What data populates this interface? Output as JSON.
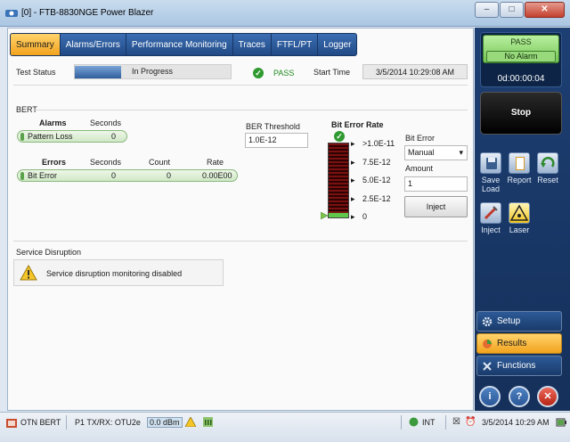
{
  "window": {
    "title": "[0] - FTB-8830NGE Power Blazer",
    "minimize": "–",
    "maximize": "□",
    "close": "✕"
  },
  "tabs": [
    "Summary",
    "Alarms/Errors",
    "Performance Monitoring",
    "Traces",
    "FTFL/PT",
    "Logger"
  ],
  "summary": {
    "test_status_label": "Test Status",
    "status_value": "In Progress",
    "verdict": "PASS",
    "start_time_label": "Start Time",
    "start_time": "3/5/2014 10:29:08 AM"
  },
  "bert": {
    "section_title": "BERT",
    "alarms_header": "Alarms",
    "seconds_header": "Seconds",
    "alarm_row": {
      "name": "Pattern Loss",
      "seconds": "0"
    },
    "errors_header": "Errors",
    "errors_seconds_header": "Seconds",
    "count_header": "Count",
    "rate_header": "Rate",
    "error_row": {
      "name": "Bit Error",
      "seconds": "0",
      "count": "0",
      "rate": "0.00E00"
    },
    "threshold_label": "BER Threshold",
    "threshold_value": "1.0E-12",
    "ber_title": "Bit Error Rate",
    "scale": [
      ">1.0E-11",
      "7.5E-12",
      "5.0E-12",
      "2.5E-12",
      "0"
    ],
    "bit_error_label": "Bit Error",
    "bit_error_mode": "Manual",
    "amount_label": "Amount",
    "amount_value": "1",
    "inject_label": "Inject"
  },
  "service_disruption": {
    "title": "Service Disruption",
    "message": "Service disruption monitoring disabled"
  },
  "side_panel": {
    "verdict": "PASS",
    "alarm_status": "No Alarm",
    "elapsed": "0d:00:00:04",
    "stop_label": "Stop",
    "tools": [
      {
        "label": "Save Load",
        "icon": "save-load-icon"
      },
      {
        "label": "Report",
        "icon": "report-icon"
      },
      {
        "label": "Reset",
        "icon": "reset-icon"
      },
      {
        "label": "Inject",
        "icon": "inject-icon"
      },
      {
        "label": "Laser",
        "icon": "laser-icon"
      }
    ],
    "nav": [
      "Setup",
      "Results",
      "Functions"
    ],
    "round_buttons": [
      "i",
      "?",
      "✕"
    ]
  },
  "statusbar": {
    "test_name": "OTN BERT",
    "port_info": "P1  TX/RX: OTU2e",
    "power": "0.0 dBm",
    "clock": "INT",
    "datetime": "3/5/2014 10:29 AM"
  },
  "colors": {
    "accent_orange": "#f2a31e",
    "tab_blue": "#204a86",
    "pass_green": "#2f9a2f",
    "meter_red": "#7b1010"
  }
}
